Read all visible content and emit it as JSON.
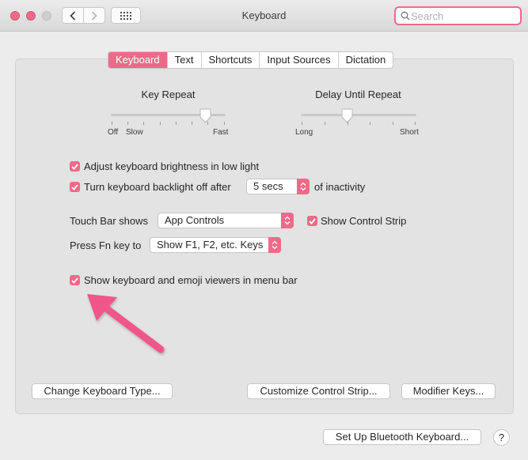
{
  "window": {
    "title": "Keyboard"
  },
  "search": {
    "placeholder": "Search",
    "value": ""
  },
  "tabs": [
    {
      "label": "Keyboard",
      "active": true
    },
    {
      "label": "Text",
      "active": false
    },
    {
      "label": "Shortcuts",
      "active": false
    },
    {
      "label": "Input Sources",
      "active": false
    },
    {
      "label": "Dictation",
      "active": false
    }
  ],
  "key_repeat": {
    "title": "Key Repeat",
    "labels": [
      "Off",
      "Slow",
      "Fast"
    ],
    "value": 0.86
  },
  "delay_until_repeat": {
    "title": "Delay Until Repeat",
    "labels": [
      "Long",
      "Short"
    ],
    "value": 0.4
  },
  "options": {
    "adjust_brightness": {
      "label": "Adjust keyboard brightness in low light",
      "checked": true
    },
    "backlight_off": {
      "label": "Turn keyboard backlight off after",
      "checked": true,
      "value": "5 secs",
      "suffix": "of inactivity"
    },
    "touch_bar": {
      "label": "Touch Bar shows",
      "value": "App Controls"
    },
    "show_control_strip": {
      "label": "Show Control Strip",
      "checked": true
    },
    "fn_key": {
      "label": "Press Fn key to",
      "value": "Show F1, F2, etc. Keys"
    },
    "viewers_menu_bar": {
      "label": "Show keyboard and emoji viewers in menu bar",
      "checked": true
    }
  },
  "buttons": {
    "change_type": "Change Keyboard Type...",
    "customize_strip": "Customize Control Strip...",
    "modifier_keys": "Modifier Keys...",
    "bluetooth": "Set Up Bluetooth Keyboard...",
    "help": "?"
  },
  "colors": {
    "accent": "#ee6a88",
    "arrow": "#f0578a"
  }
}
